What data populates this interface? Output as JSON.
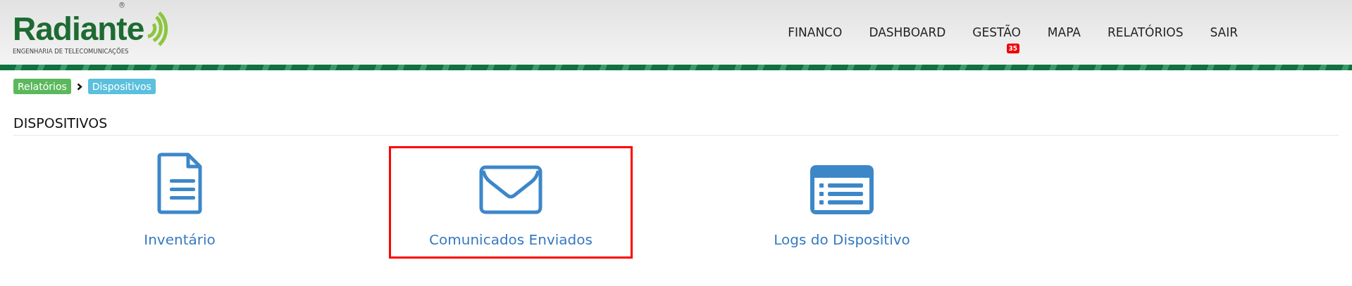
{
  "logo": {
    "name": "Radiante",
    "mark": "®",
    "tagline": "ENGENHARIA DE TELECOMUNICAÇÕES"
  },
  "nav": [
    {
      "label": "FINANCO"
    },
    {
      "label": "DASHBOARD"
    },
    {
      "label": "GESTÃO",
      "badge": "35"
    },
    {
      "label": "MAPA"
    },
    {
      "label": "RELATÓRIOS"
    },
    {
      "label": "SAIR"
    }
  ],
  "breadcrumb": [
    {
      "label": "Relatórios",
      "kind": "parent"
    },
    {
      "label": "Dispositivos",
      "kind": "current"
    }
  ],
  "heading": "DISPOSITIVOS",
  "cards": [
    {
      "label": "Inventário",
      "kind": "document",
      "selected": false
    },
    {
      "label": "Comunicados Enviados",
      "kind": "envelope",
      "selected": true
    },
    {
      "label": "Logs do Dispositivo",
      "kind": "list",
      "selected": false
    }
  ]
}
